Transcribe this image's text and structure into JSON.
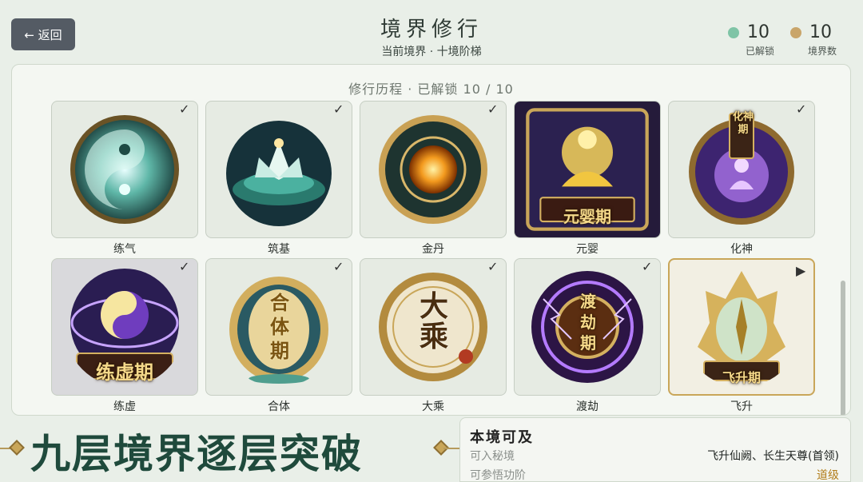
{
  "header": {
    "back_label": "← 返回",
    "title": "境界修行",
    "subtitle": "当前境界 · 十境阶梯"
  },
  "stats": [
    {
      "value": "10",
      "label": "已解锁",
      "color": "#7fc4a6"
    },
    {
      "value": "10",
      "label": "境界数",
      "color": "#c9a56a"
    }
  ],
  "panel": {
    "title": "修行历程 · 已解锁 10 / 10"
  },
  "realms": [
    {
      "name": "练气",
      "status": "unlocked"
    },
    {
      "name": "筑基",
      "status": "unlocked"
    },
    {
      "name": "金丹",
      "status": "unlocked"
    },
    {
      "name": "元婴",
      "status": "unlocked",
      "emblem_text": "元婴期"
    },
    {
      "name": "化神",
      "status": "unlocked",
      "emblem_text": "化神期"
    },
    {
      "name": "练虚",
      "status": "unlocked",
      "emblem_text": "练虚期"
    },
    {
      "name": "合体",
      "status": "unlocked",
      "emblem_text": "合体期"
    },
    {
      "name": "大乘",
      "status": "unlocked",
      "emblem_text": "大乘"
    },
    {
      "name": "渡劫",
      "status": "unlocked",
      "emblem_text": "渡劫期"
    },
    {
      "name": "飞升",
      "status": "current",
      "emblem_text": "飞升期"
    }
  ],
  "banner": {
    "text": "九层境界逐层突破"
  },
  "info": {
    "title": "本境可及",
    "rows": [
      {
        "key": "可入秘境",
        "value": "飞升仙阙、长生天尊(首领)"
      },
      {
        "key": "可参悟功阶",
        "value": "道级"
      }
    ]
  },
  "colors": {
    "accent_gold": "#c9a659",
    "banner_green": "#1f4a3c"
  }
}
